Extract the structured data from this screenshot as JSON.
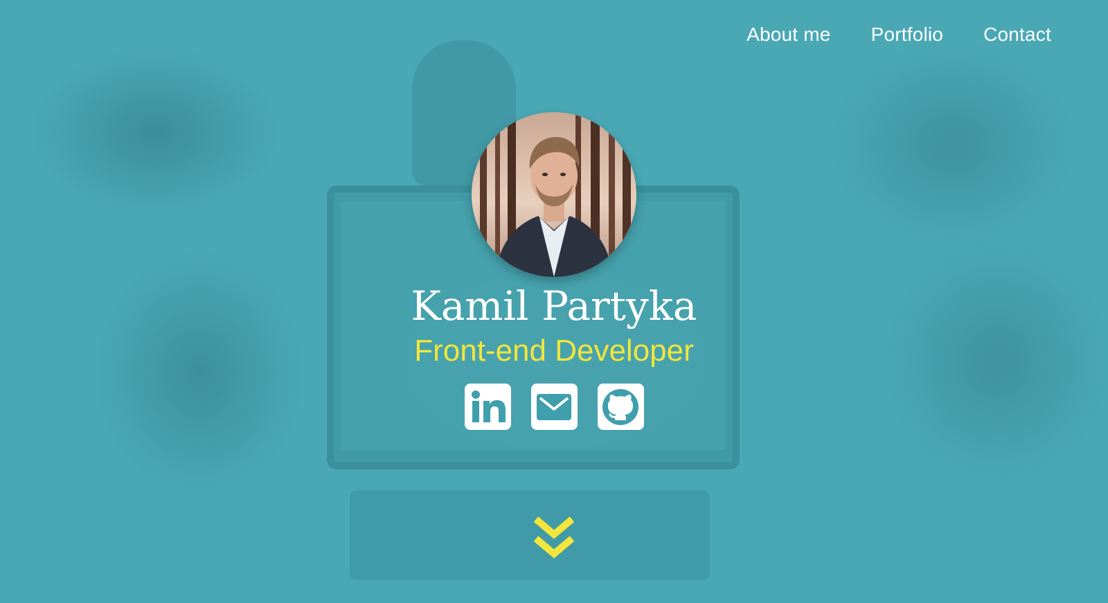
{
  "nav": {
    "items": [
      {
        "label": "About me"
      },
      {
        "label": "Portfolio"
      },
      {
        "label": "Contact"
      }
    ]
  },
  "profile": {
    "name": "Kamil Partyka",
    "role": "Front-end Developer"
  },
  "socials": [
    {
      "icon": "linkedin-icon"
    },
    {
      "icon": "mail-icon"
    },
    {
      "icon": "github-icon"
    }
  ],
  "scroll": {
    "icon": "double-chevron-down-icon"
  },
  "colors": {
    "background": "#4aa8b5",
    "accent": "#f2e53c",
    "text": "#ffffff",
    "icon": "#3f9fad"
  }
}
